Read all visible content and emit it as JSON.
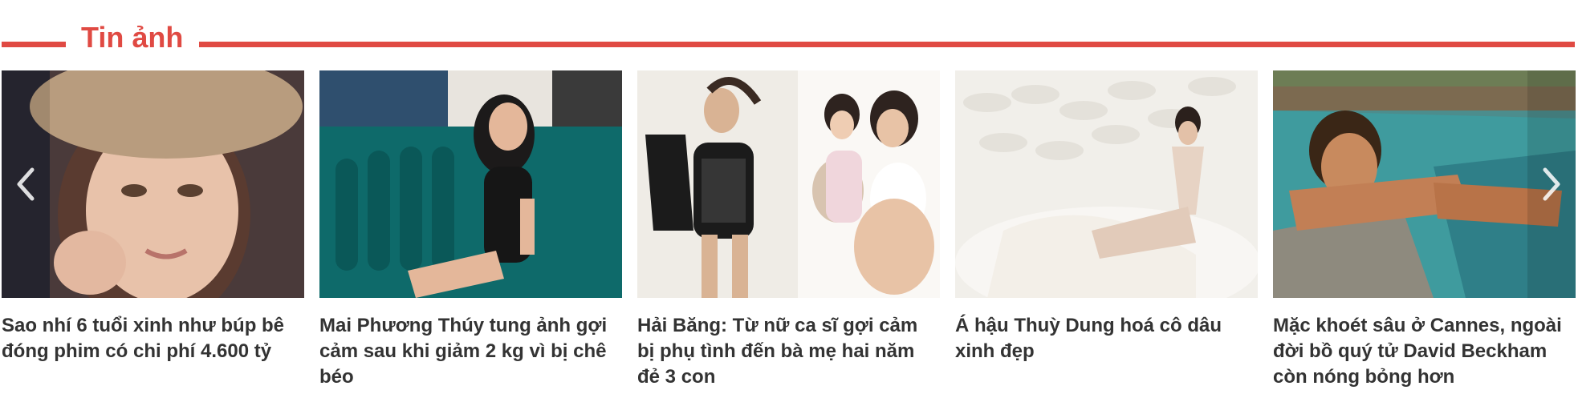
{
  "section": {
    "title": "Tin ảnh",
    "accent_color": "#e04a43"
  },
  "carousel": {
    "prev_icon": "chevron-left-icon",
    "next_icon": "chevron-right-icon",
    "items": [
      {
        "caption": "Sao nhí 6 tuổi xinh như búp bê đóng phim có chi phí 4.600 tỷ"
      },
      {
        "caption": "Mai Phương Thúy tung ảnh gợi cảm sau khi giảm 2 kg vì bị chê béo"
      },
      {
        "caption": "Hải Băng: Từ nữ ca sĩ gợi cảm bị phụ tình đến bà mẹ hai năm đẻ 3 con"
      },
      {
        "caption": "Á hậu Thuỳ Dung hoá cô dâu xinh đẹp"
      },
      {
        "caption": "Mặc khoét sâu ở Cannes, ngoài đời bồ quý tử David Beckham còn nóng bỏng hơn"
      }
    ]
  }
}
